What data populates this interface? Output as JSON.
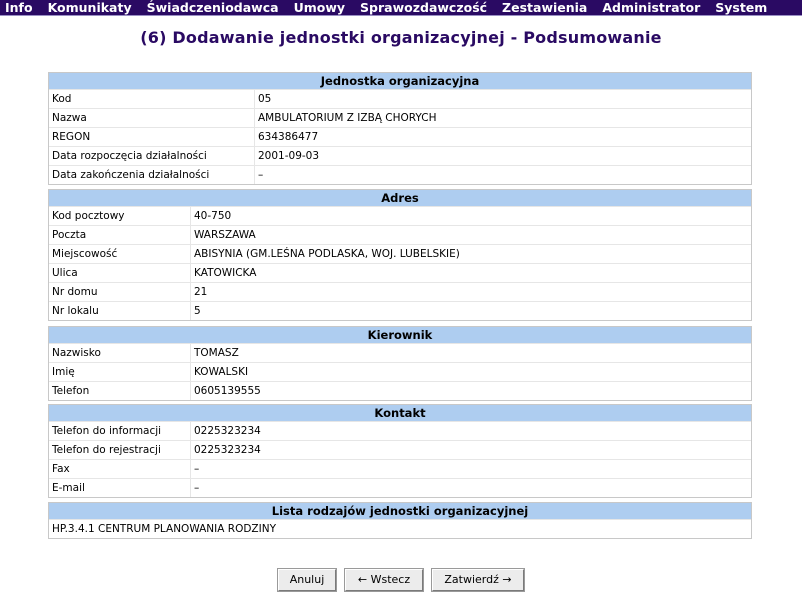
{
  "menu": [
    "Info",
    "Komunikaty",
    "Świadczeniodawca",
    "Umowy",
    "Sprawozdawczość",
    "Zestawienia",
    "Administrator",
    "System"
  ],
  "page_title": "(6) Dodawanie jednostki organizacyjnej - Podsumowanie",
  "jednostka": {
    "header": "Jednostka organizacyjna",
    "rows": [
      {
        "label": "Kod",
        "value": "05"
      },
      {
        "label": "Nazwa",
        "value": "AMBULATORIUM Z IZBĄ CHORYCH"
      },
      {
        "label": "REGON",
        "value": "634386477"
      },
      {
        "label": "Data rozpoczęcia działalności",
        "value": "2001-09-03"
      },
      {
        "label": "Data zakończenia działalności",
        "value": "–"
      }
    ]
  },
  "adres": {
    "header": "Adres",
    "rows": [
      {
        "label": "Kod pocztowy",
        "value": "40-750"
      },
      {
        "label": "Poczta",
        "value": "WARSZAWA"
      },
      {
        "label": "Miejscowość",
        "value": "ABISYNIA (GM.LEŚNA PODLASKA, WOJ. LUBELSKIE)"
      },
      {
        "label": "Ulica",
        "value": "KATOWICKA"
      },
      {
        "label": "Nr domu",
        "value": "21"
      },
      {
        "label": "Nr lokalu",
        "value": "5"
      }
    ]
  },
  "kierownik": {
    "header": "Kierownik",
    "rows": [
      {
        "label": "Nazwisko",
        "value": "TOMASZ"
      },
      {
        "label": "Imię",
        "value": "KOWALSKI"
      },
      {
        "label": "Telefon",
        "value": "0605139555"
      }
    ]
  },
  "kontakt": {
    "header": "Kontakt",
    "rows": [
      {
        "label": "Telefon do informacji",
        "value": "0225323234"
      },
      {
        "label": "Telefon do rejestracji",
        "value": "0225323234"
      },
      {
        "label": "Fax",
        "value": "–"
      },
      {
        "label": "E-mail",
        "value": "–"
      }
    ]
  },
  "lista": {
    "header": "Lista rodzajów jednostki organizacyjnej",
    "items": [
      "HP.3.4.1 CENTRUM PLANOWANIA RODZINY"
    ]
  },
  "buttons": {
    "cancel": "Anuluj",
    "back": "← Wstecz",
    "confirm": "Zatwierdź →"
  },
  "colors": {
    "menubar": "#2a0a63",
    "title": "#2a0a63",
    "section_header": "#aecdf0"
  }
}
